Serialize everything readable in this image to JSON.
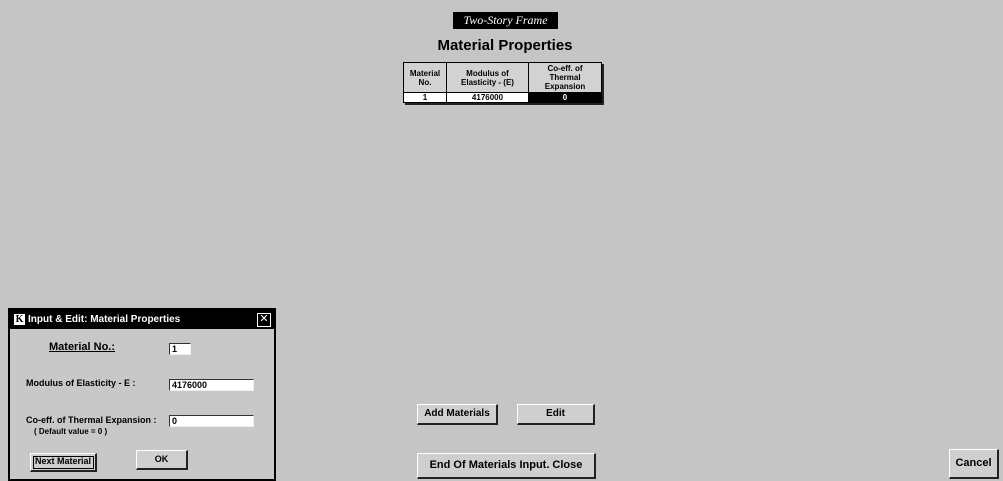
{
  "header": {
    "frame_title": "Two-Story Frame",
    "page_title": "Material Properties"
  },
  "material_table": {
    "columns": [
      "Material No.",
      "Modulus of Elasticity - (E)",
      "Co-eff. of Thermal Expansion"
    ],
    "rows": [
      [
        "1",
        "4176000",
        "0"
      ]
    ]
  },
  "buttons": {
    "add_materials": "Add Materials",
    "edit": "Edit",
    "end_close": "End Of Materials Input. Close",
    "cancel": "Cancel"
  },
  "dialog": {
    "title": "Input & Edit: Material Properties",
    "logo_letter": "K",
    "close_glyph": "✕",
    "material_no_label": "Material No.:",
    "material_no_value": "1",
    "modulus_label": "Modulus of Elasticity - E :",
    "modulus_value": "4176000",
    "coeff_label": "Co-eff. of Thermal Expansion :",
    "coeff_default": "( Default value = 0 )",
    "coeff_value": "0",
    "next_button": "Next Material",
    "ok_button": "OK"
  }
}
